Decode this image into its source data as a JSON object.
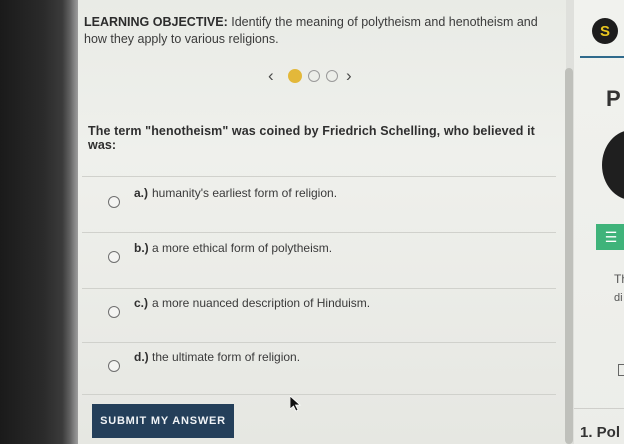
{
  "objective": {
    "label": "LEARNING OBJECTIVE:",
    "text": "Identify the meaning of polytheism and henotheism and how they apply to various religions."
  },
  "carousel": {
    "prev_icon": "‹",
    "next_icon": "›",
    "active_index": 0,
    "dot_count": 3
  },
  "question": "The term \"henotheism\" was coined by Friedrich Schelling, who believed it was:",
  "options": [
    {
      "letter": "a.)",
      "text": "humanity's earliest form of religion."
    },
    {
      "letter": "b.)",
      "text": "a more ethical form of polytheism."
    },
    {
      "letter": "c.)",
      "text": "a more nuanced description of Hinduism."
    },
    {
      "letter": "d.)",
      "text": "the ultimate form of religion."
    }
  ],
  "submit_label": "SUBMIT MY ANSWER",
  "right_panel": {
    "logo": "S",
    "heading_fragment": "P",
    "list_icon": "☰",
    "text_fragment_1": "Th",
    "text_fragment_2": "di",
    "bottom_fragment": "1. Pol"
  },
  "colors": {
    "submit_bg": "#243f5a",
    "active_dot": "#e3b83a",
    "logo_accent": "#e9c61f",
    "list_icon_bg": "#3fb37a",
    "header_line": "#2f6a8c"
  }
}
